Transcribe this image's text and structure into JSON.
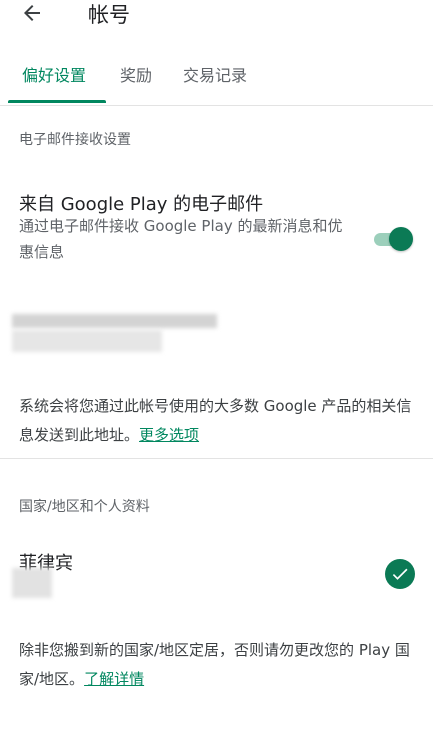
{
  "header": {
    "back_icon": "arrow-left-icon",
    "title": "帐号"
  },
  "tabs": [
    {
      "label": "偏好设置",
      "active": true
    },
    {
      "label": "奖励",
      "active": false
    },
    {
      "label": "交易记录",
      "active": false
    }
  ],
  "email_section": {
    "header": "电子邮件接收设置",
    "item_title": "来自 Google Play 的电子邮件",
    "item_subtitle": "通过电子邮件接收 Google Play 的最新消息和优惠信息",
    "toggle_on": true,
    "info_text": "系统会将您通过此帐号使用的大多数 Google 产品的相关信息发送到此地址。",
    "info_link": "更多选项"
  },
  "country_section": {
    "header": "国家/地区和个人资料",
    "country": "菲律宾",
    "selected_icon": "check-circle-icon",
    "info_text": "除非您搬到新的国家/地区定居，否则请勿更改您的 Play 国家/地区。",
    "info_link": "了解详情"
  },
  "colors": {
    "accent": "#01875f",
    "switch_thumb": "#0b7a55",
    "switch_track": "#9ccfbb"
  }
}
